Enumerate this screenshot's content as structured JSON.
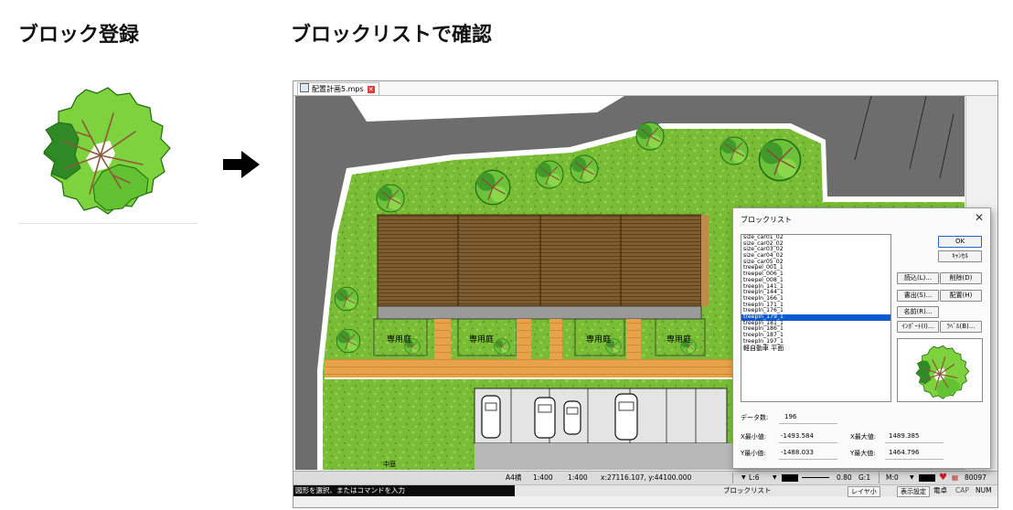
{
  "headings": {
    "left": "ブロック登録",
    "right": "ブロックリストで確認"
  },
  "icons": {
    "arrow": "black-right-arrow-icon",
    "tree": "tree-top-view-icon"
  },
  "colors": {
    "road": "#6d6d6d",
    "grass": "#7ec13a",
    "roof": "#7a5a2c",
    "path": "#e7a24a",
    "tree_light": "#7ed23e",
    "tree_dark": "#3d9a2a",
    "selection": "#0a5bd1"
  },
  "document_tab": {
    "title": "配置計画5.mps"
  },
  "plan": {
    "garden_labels": [
      "専用庭",
      "専用庭",
      "専用庭",
      "専用庭"
    ],
    "small_label": "中庭"
  },
  "status_bar": {
    "paper": "A4横",
    "scale_1": "1:400",
    "scale_2": "1:400",
    "coords": "x:27116.107, y:44100.000",
    "layer": "L:6",
    "line_width": "0.80",
    "grid": "G:1",
    "mode": "M:0",
    "count": "80097",
    "message": "図形を選択、またはコマンドを入力",
    "block_list": "ブロックリスト",
    "layer_small": "レイヤ小",
    "display_settings": "表示設定",
    "snap": "電卓",
    "caps": "CAP",
    "numlock": "NUM"
  },
  "dialog": {
    "title": "ブロックリスト",
    "items": [
      "size_car01_02",
      "size_car02_02",
      "size_car03_02",
      "size_car04_02",
      "size_car05_02",
      "treepel_001_1",
      "treepel_006_1",
      "treepel_008_1",
      "treepln_141_1",
      "treepln_144_1",
      "treepln_166_1",
      "treepln_171_1",
      "treepln_176_1",
      "treepln_179_1",
      "treepln_181_1",
      "treepln_186_1",
      "treepln_187_1",
      "treepln_197_1",
      "軽自動車 平面"
    ],
    "selected_index": 13,
    "buttons": {
      "ok": "OK",
      "cancel": "ｷｬﾝｾﾙ",
      "load": "読込(L)...",
      "delete": "削除(D)",
      "export": "書出(S)...",
      "place": "配置(H)",
      "rename": "名前(R)...",
      "import": "ｲﾝﾎﾟｰﾄ(I)...",
      "label": "ﾗﾍﾞﾙ(B)..."
    },
    "fields": {
      "data_count_label": "データ数:",
      "data_count_value": "196",
      "xmin_label": "X最小値:",
      "xmin_value": "-1493.584",
      "xmax_label": "X最大値:",
      "xmax_value": "1489.385",
      "ymin_label": "Y最小値:",
      "ymin_value": "-1488.033",
      "ymax_label": "Y最大値:",
      "ymax_value": "1464.796"
    }
  }
}
